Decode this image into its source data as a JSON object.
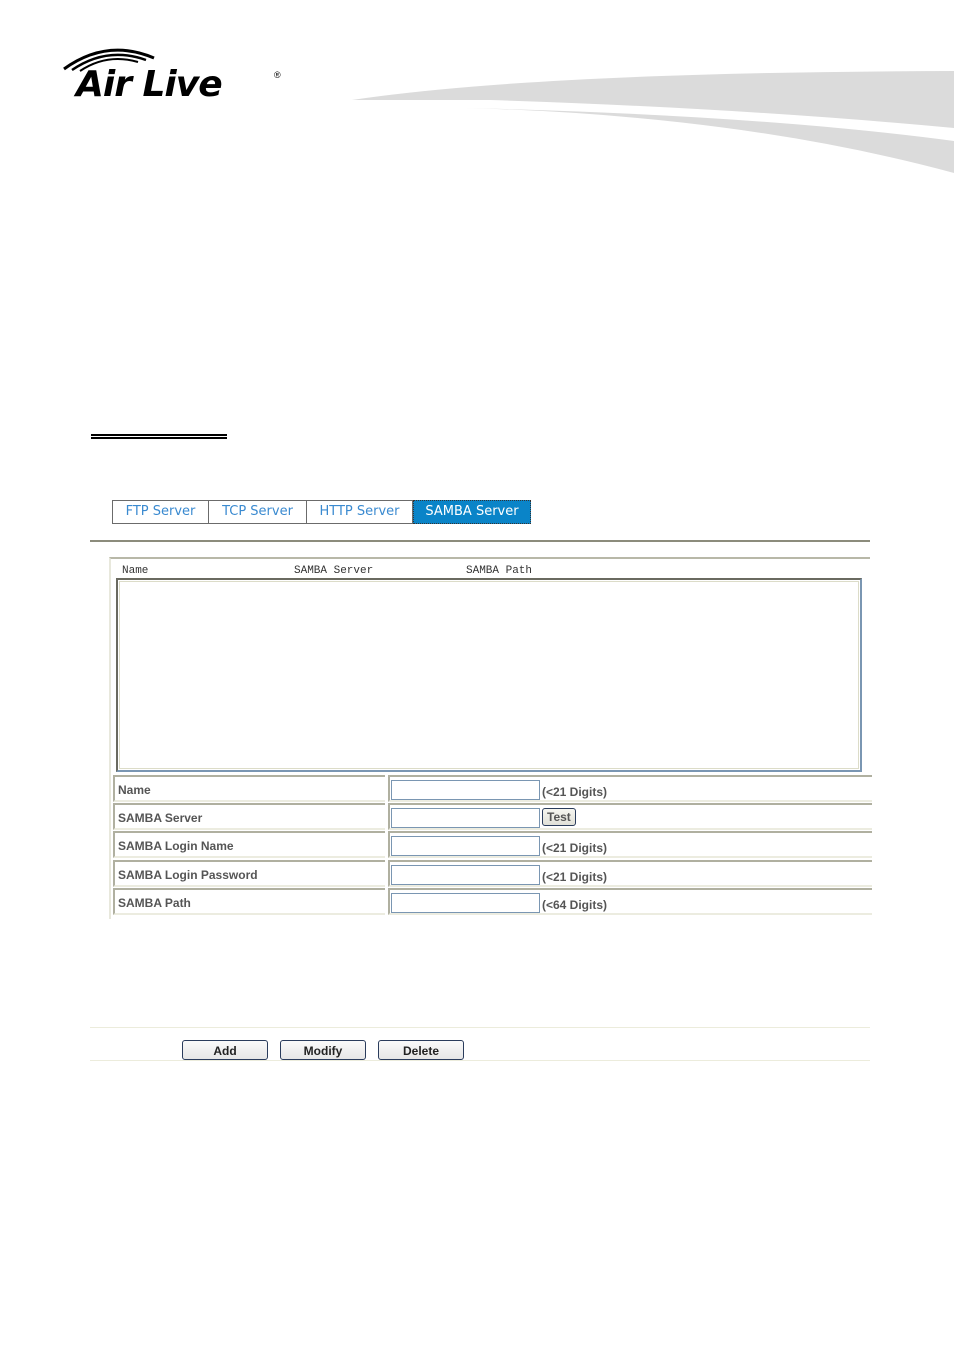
{
  "brand": {
    "logo_text": "Air Live",
    "registered_mark": "®"
  },
  "tabs": [
    {
      "label": "FTP Server",
      "active": false
    },
    {
      "label": "TCP Server",
      "active": false
    },
    {
      "label": "HTTP Server",
      "active": false
    },
    {
      "label": "SAMBA Server",
      "active": true
    }
  ],
  "list": {
    "columns": [
      "Name",
      "SAMBA Server",
      "SAMBA Path"
    ],
    "rows": []
  },
  "form": {
    "fields": [
      {
        "label": "Name",
        "value": "",
        "hint": "(<21 Digits)"
      },
      {
        "label": "SAMBA Server",
        "value": "",
        "button": "Test"
      },
      {
        "label": "SAMBA Login Name",
        "value": "",
        "hint": "(<21 Digits)"
      },
      {
        "label": "SAMBA Login Password",
        "value": "",
        "hint": "(<21 Digits)"
      },
      {
        "label": "SAMBA Path",
        "value": "",
        "hint": "(<64 Digits)"
      }
    ]
  },
  "actions": {
    "add": "Add",
    "modify": "Modify",
    "delete": "Delete"
  },
  "colors": {
    "active_tab": "#0a84c8",
    "tab_text": "#3a8ad0"
  }
}
